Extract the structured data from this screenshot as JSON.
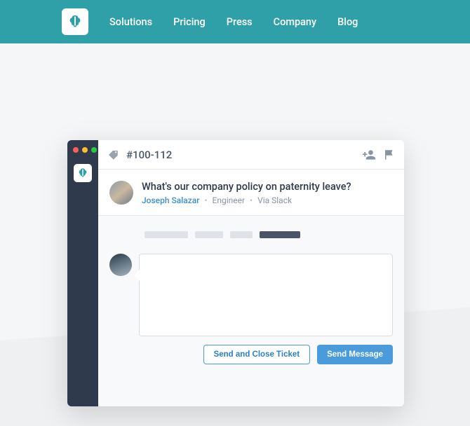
{
  "nav": {
    "items": [
      "Solutions",
      "Pricing",
      "Press",
      "Company",
      "Blog"
    ]
  },
  "ticket": {
    "id": "#100-112",
    "question": "What's our company policy on paternity leave?",
    "author": "Joseph Salazar",
    "role": "Engineer",
    "source": "Via Slack"
  },
  "buttons": {
    "send_close": "Send and Close Ticket",
    "send": "Send Message"
  }
}
